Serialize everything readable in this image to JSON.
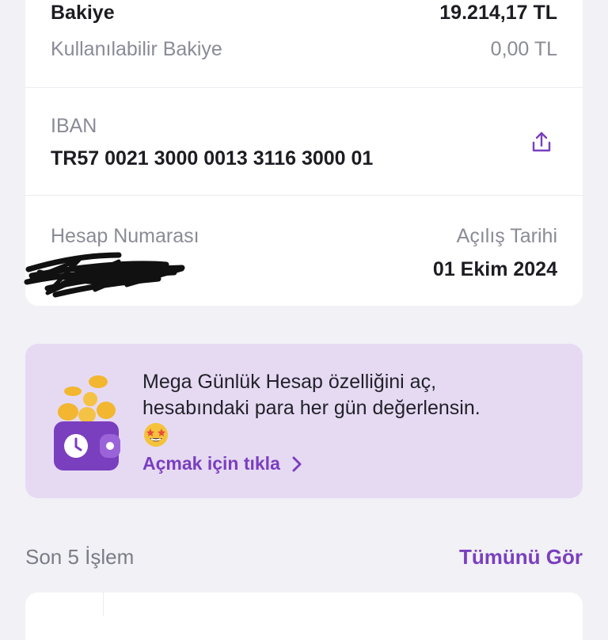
{
  "balance": {
    "label": "Bakiye",
    "value": "19.214,17 TL",
    "available_label": "Kullanılabilir Bakiye",
    "available_value": "0,00 TL"
  },
  "iban": {
    "label": "IBAN",
    "value": "TR57 0021 3000 0013 3116 3000 01",
    "share_icon": "share-icon"
  },
  "account": {
    "number_label": "Hesap Numarası",
    "number_value": "",
    "opening_label": "Açılış Tarihi",
    "opening_value": "01 Ekim 2024"
  },
  "promo": {
    "line1": "Mega Günlük Hesap özelliğini aç,",
    "line2": "hesabındaki para her gün değerlensin.",
    "link_label": "Açmak için tıkla",
    "icons": [
      "wallet-coins-icon",
      "star-struck-emoji-icon",
      "chevron-right-icon"
    ]
  },
  "transactions": {
    "title": "Son 5 İşlem",
    "see_all_label": "Tümünü Gör"
  },
  "colors": {
    "accent": "#7a3fbf",
    "background": "#f1f1f6",
    "promo_background": "#e6daf3"
  }
}
